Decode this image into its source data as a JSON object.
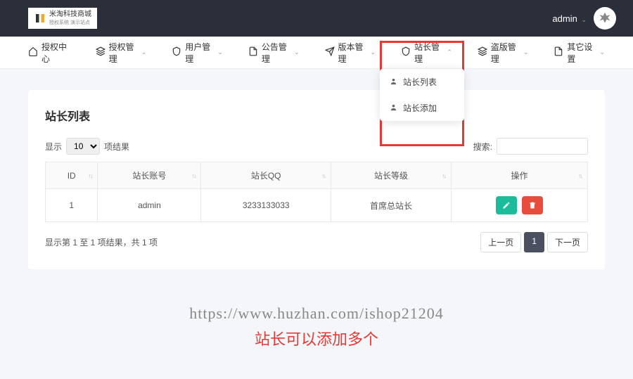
{
  "brand": {
    "name": "米淘科技商城",
    "sub": "授权系统 演示站点"
  },
  "user": {
    "name": "admin"
  },
  "nav": [
    {
      "label": "授权中心",
      "icon": "home"
    },
    {
      "label": "授权管理",
      "icon": "layers",
      "caret": true
    },
    {
      "label": "用户管理",
      "icon": "shield",
      "caret": true
    },
    {
      "label": "公告管理",
      "icon": "doc",
      "caret": true
    },
    {
      "label": "版本管理",
      "icon": "plane",
      "caret": true
    },
    {
      "label": "站长管理",
      "icon": "shield",
      "caret": true,
      "open": true
    },
    {
      "label": "盗版管理",
      "icon": "layers",
      "caret": true
    },
    {
      "label": "其它设置",
      "icon": "doc",
      "caret": true
    }
  ],
  "dropdown": [
    {
      "label": "站长列表"
    },
    {
      "label": "站长添加"
    }
  ],
  "page": {
    "title": "站长列表",
    "length_prefix": "显示",
    "length_value": "10",
    "length_suffix": "项结果",
    "search_label": "搜索:",
    "info": "显示第 1 至 1 项结果，共 1 项",
    "prev": "上一页",
    "page_num": "1",
    "next": "下一页"
  },
  "table": {
    "headers": [
      "ID",
      "站长账号",
      "站长QQ",
      "站长等级",
      "操作"
    ],
    "rows": [
      {
        "id": "1",
        "account": "admin",
        "qq": "3233133033",
        "level": "首席总站长"
      }
    ]
  },
  "watermark": {
    "url": "https://www.huzhan.com/ishop21204",
    "note": "站长可以添加多个"
  }
}
